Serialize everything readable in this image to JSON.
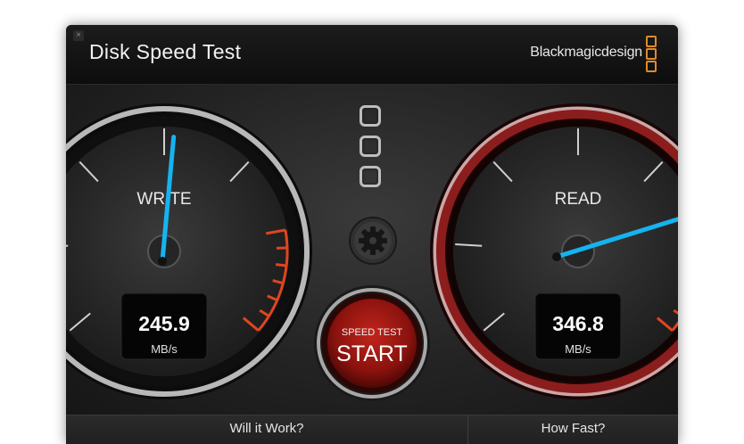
{
  "window": {
    "title": "Disk Speed Test",
    "brand": "Blackmagicdesign",
    "close_glyph": "×"
  },
  "write_gauge": {
    "label": "WRITE",
    "value": "245.9",
    "unit": "MB/s",
    "fraction": 0.52
  },
  "read_gauge": {
    "label": "READ",
    "value": "346.8",
    "unit": "MB/s",
    "fraction": 0.78
  },
  "start_button": {
    "top_label": "SPEED TEST",
    "main_label": "START"
  },
  "settings": {
    "icon": "gear-icon"
  },
  "footer": {
    "left_tab": "Will it Work?",
    "right_tab": "How Fast?"
  },
  "colors": {
    "needle": "#16b3f0",
    "read_ring": "#8c1d1d",
    "redline": "#e0451e",
    "logo": "#e08a2a"
  }
}
